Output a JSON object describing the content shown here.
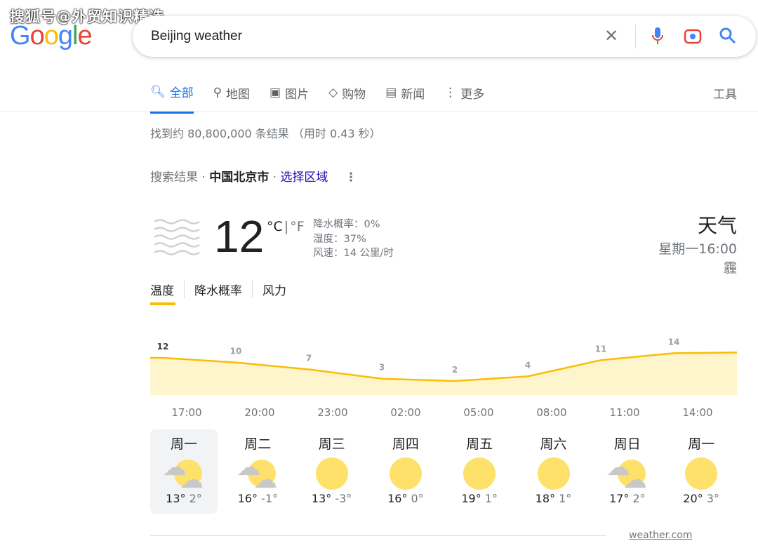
{
  "watermark": "搜狐号@外贸知识精选",
  "logo": "Google",
  "search": {
    "query": "Beijing weather",
    "icons": [
      "close-icon",
      "mic-icon",
      "camera-icon",
      "search-icon"
    ]
  },
  "tabs": [
    {
      "label": "全部",
      "icon": "search-icon",
      "active": true
    },
    {
      "label": "地图",
      "icon": "map-pin-icon"
    },
    {
      "label": "图片",
      "icon": "image-icon"
    },
    {
      "label": "购物",
      "icon": "tag-icon"
    },
    {
      "label": "新闻",
      "icon": "news-icon"
    },
    {
      "label": "更多",
      "icon": "more-vert-icon"
    }
  ],
  "tools": "工具",
  "stats": "找到约 80,800,000 条结果 （用时 0.43 秒）",
  "location": {
    "prefix": "搜索结果 · ",
    "place": "中国北京市",
    "sep": " · ",
    "change": "选择区域"
  },
  "weather": {
    "temp": "12",
    "unit_c": "°C",
    "unit_f": "°F",
    "precip": "降水概率：0%",
    "humidity": "湿度：37%",
    "wind": "风速：14 公里/时",
    "title": "天气",
    "datetime": "星期一16:00",
    "condition": "霾",
    "icon": "haze-icon"
  },
  "chart_tabs": [
    "温度",
    "降水概率",
    "风力"
  ],
  "colors": {
    "accent": "#fbbc04",
    "fill": "#fef5cc",
    "link": "#1a0dab",
    "tab_active": "#1a73e8"
  },
  "chart_data": {
    "type": "area",
    "x": [
      "17:00",
      "20:00",
      "23:00",
      "02:00",
      "05:00",
      "08:00",
      "11:00",
      "14:00"
    ],
    "values": [
      12,
      10,
      7,
      3,
      2,
      4,
      11,
      14
    ],
    "labels": [
      "12",
      "10",
      "7",
      "3",
      "2",
      "4",
      "11",
      "14"
    ]
  },
  "days": [
    {
      "name": "周一",
      "icon": "partly-cloudy-icon",
      "high": "13°",
      "low": "2°",
      "selected": true
    },
    {
      "name": "周二",
      "icon": "partly-cloudy-icon",
      "high": "16°",
      "low": "-1°"
    },
    {
      "name": "周三",
      "icon": "sunny-icon",
      "high": "13°",
      "low": "-3°"
    },
    {
      "name": "周四",
      "icon": "sunny-icon",
      "high": "16°",
      "low": "0°"
    },
    {
      "name": "周五",
      "icon": "sunny-icon",
      "high": "19°",
      "low": "1°"
    },
    {
      "name": "周六",
      "icon": "sunny-icon",
      "high": "18°",
      "low": "1°"
    },
    {
      "name": "周日",
      "icon": "partly-cloudy-icon",
      "high": "17°",
      "low": "2°"
    },
    {
      "name": "周一",
      "icon": "sunny-icon",
      "high": "20°",
      "low": "3°"
    }
  ],
  "source": "weather.com"
}
